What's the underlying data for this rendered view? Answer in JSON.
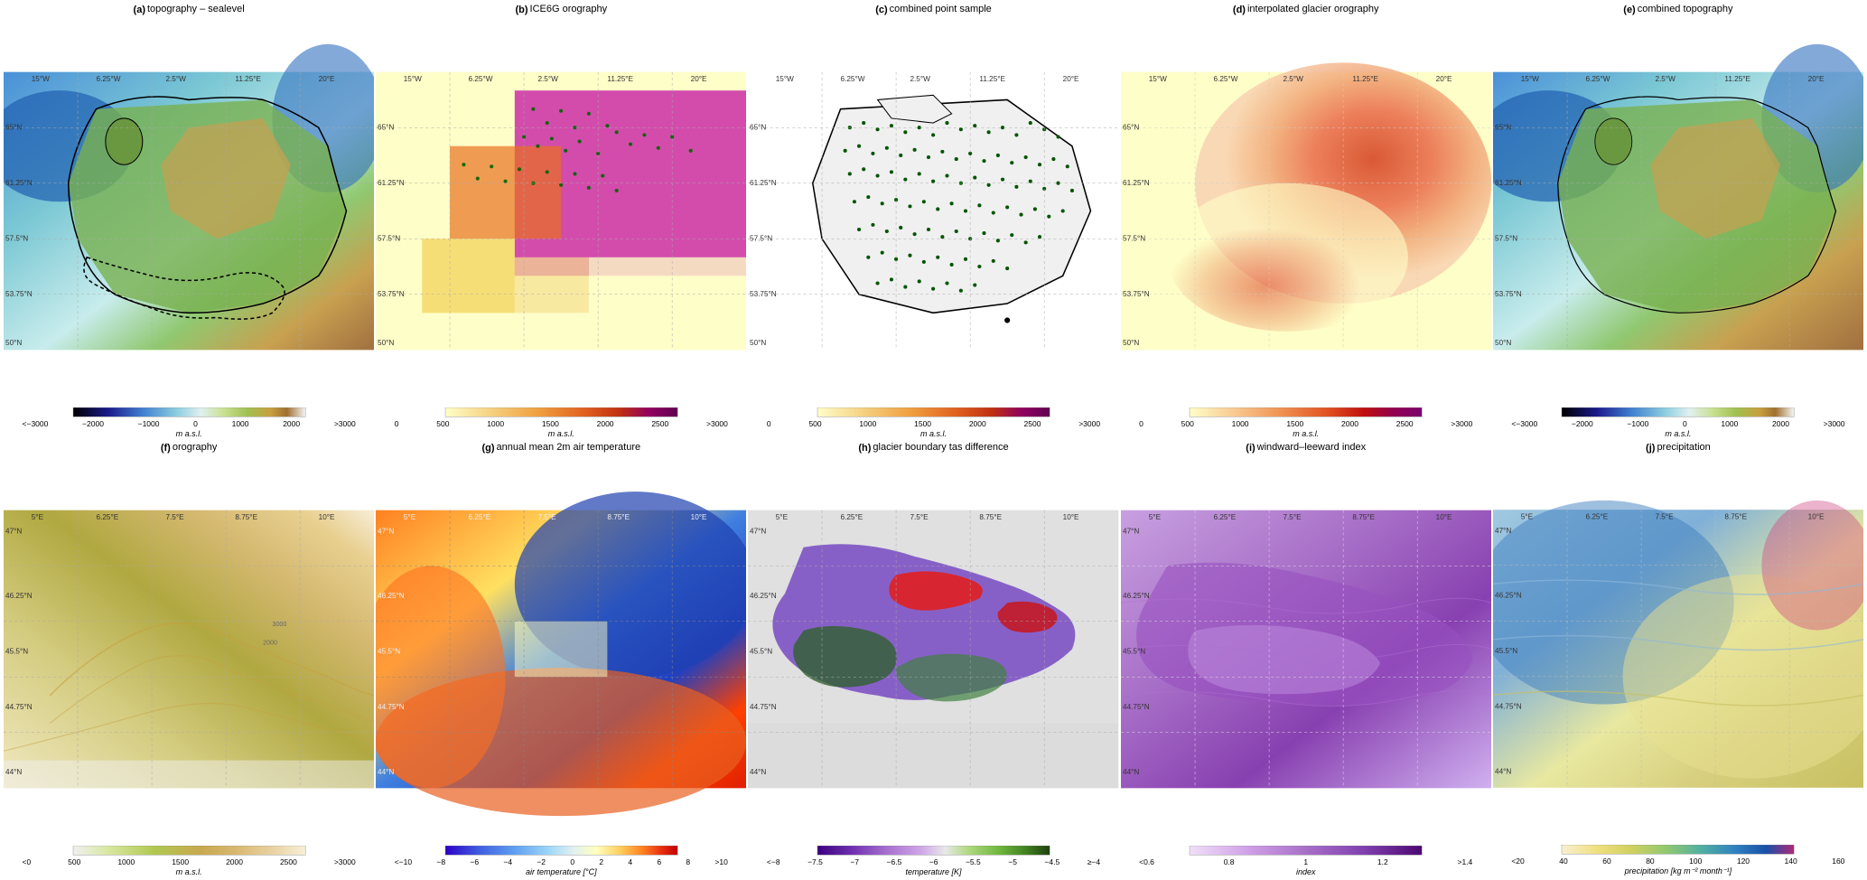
{
  "panels": {
    "row1": [
      {
        "id": "a",
        "label": "(a)",
        "title": "topography – sealevel",
        "colorbar": {
          "type": "topography_full",
          "labels": [
            "<−3000",
            "−2000",
            "−1000",
            "0",
            "1000",
            "2000",
            ">3000"
          ],
          "unit": "m a.s.l.",
          "colors": [
            "#000000",
            "#1a1a8c",
            "#2c5ff5",
            "#7db8d4",
            "#c8ecec",
            "#e8f5e0",
            "#a8d890",
            "#78b050",
            "#c8a050",
            "#c87830",
            "#8b4513",
            "#f5f5f5"
          ]
        },
        "map_style": "topography_sealevel",
        "grid_labels": {
          "top": [
            "15°W",
            "6.25°W",
            "2.5°W",
            "11.25°E",
            "20°E"
          ],
          "left": [
            "65°N",
            "61.25°N",
            "57.5°N",
            "53.75°N",
            "50°N"
          ]
        }
      },
      {
        "id": "b",
        "label": "(b)",
        "title": "ICE6G orography",
        "colorbar": {
          "type": "warm",
          "labels": [
            "0",
            "500",
            "1000",
            "1500",
            "2000",
            "2500",
            ">3000"
          ],
          "unit": "m a.s.l.",
          "colors": [
            "#fefec8",
            "#f5e090",
            "#f0b840",
            "#e87020",
            "#d03010",
            "#a00080",
            "#5c0060"
          ]
        },
        "map_style": "ice6g",
        "grid_labels": {
          "top": [
            "15°W",
            "6.25°W",
            "2.5°W",
            "11.25°E",
            "20°E"
          ],
          "left": [
            "65°N",
            "61.25°N",
            "57.5°N",
            "53.75°N",
            "50°N"
          ]
        }
      },
      {
        "id": "c",
        "label": "(c)",
        "title": "combined point sample",
        "colorbar": {
          "type": "warm",
          "labels": [
            "0",
            "500",
            "1000",
            "1500",
            "2000",
            "2500",
            ">3000"
          ],
          "unit": "m a.s.l.",
          "colors": [
            "#fefec8",
            "#f5e090",
            "#f0b840",
            "#e87020",
            "#d03010",
            "#a00080",
            "#5c0060"
          ]
        },
        "map_style": "point_sample",
        "grid_labels": {
          "top": [
            "15°W",
            "6.25°W",
            "2.5°W",
            "11.25°E",
            "20°E"
          ],
          "left": [
            "65°N",
            "61.25°N",
            "57.5°N",
            "53.75°N",
            "50°N"
          ]
        }
      },
      {
        "id": "d",
        "label": "(d)",
        "title": "interpolated glacier orography",
        "colorbar": {
          "type": "warm",
          "labels": [
            "0",
            "500",
            "1000",
            "1500",
            "2000",
            "2500",
            ">3000"
          ],
          "unit": "m a.s.l.",
          "colors": [
            "#fefec8",
            "#f5d0a0",
            "#f0a060",
            "#e06030",
            "#cc2010",
            "#aa0050",
            "#7a0070"
          ]
        },
        "map_style": "glacier_orography",
        "grid_labels": {
          "top": [
            "15°W",
            "6.25°W",
            "2.5°W",
            "11.25°E",
            "20°E"
          ],
          "left": [
            "65°N",
            "61.25°N",
            "57.5°N",
            "53.75°N",
            "50°N"
          ]
        }
      },
      {
        "id": "e",
        "label": "(e)",
        "title": "combined topography",
        "colorbar": {
          "type": "topography_full",
          "labels": [
            "<−3000",
            "−2000",
            "−1000",
            "0",
            "1000",
            "2000",
            ">3000"
          ],
          "unit": "m a.s.l.",
          "colors": [
            "#000000",
            "#1a1a8c",
            "#2c5ff5",
            "#7db8d4",
            "#c8ecec",
            "#e8f5e0",
            "#a8d890",
            "#78b050",
            "#c8a050",
            "#c87830",
            "#8b4513",
            "#f5f5f5"
          ]
        },
        "map_style": "combined_topography",
        "grid_labels": {
          "top": [
            "15°W",
            "6.25°W",
            "2.5°W",
            "11.25°E",
            "20°E"
          ],
          "left": [
            "65°N",
            "61.25°N",
            "57.5°N",
            "53.75°N",
            "50°N"
          ]
        }
      }
    ],
    "row2": [
      {
        "id": "f",
        "label": "(f)",
        "title": "orography",
        "colorbar": {
          "type": "orography",
          "labels": [
            "<0",
            "500",
            "1000",
            "1500",
            "2000",
            "2500",
            ">3000"
          ],
          "unit": "m a.s.l.",
          "colors": [
            "#e8f0c0",
            "#d0d870",
            "#a8b840",
            "#809030",
            "#b8a060",
            "#d0c080",
            "#f0e0b0",
            "#f8f0d8"
          ]
        },
        "map_style": "orography",
        "grid_labels": {
          "top": [
            "5°E",
            "6.25°E",
            "7.5°E",
            "8.75°E",
            "10°E"
          ],
          "left": [
            "47°N",
            "46.25°N",
            "45.5°N",
            "44.75°N",
            "44°N"
          ]
        }
      },
      {
        "id": "g",
        "label": "(g)",
        "title": "annual mean 2m air temperature",
        "colorbar": {
          "type": "temperature",
          "labels": [
            "<−10",
            "−8",
            "−6",
            "−4",
            "−2",
            "0",
            "2",
            "4",
            "6",
            "8",
            ">10"
          ],
          "unit": "air temperature [°C]",
          "colors": [
            "#2c00c8",
            "#4060e0",
            "#60a0f0",
            "#90d0f8",
            "#c0ecf8",
            "#ffffc0",
            "#ffd060",
            "#ff8020",
            "#e83010",
            "#c00000"
          ]
        },
        "map_style": "temperature",
        "grid_labels": {
          "top": [
            "5°E",
            "6.25°E",
            "7.5°E",
            "8.75°E",
            "10°E"
          ],
          "left": [
            "47°N",
            "46.25°N",
            "45.5°N",
            "44.75°N",
            "44°N"
          ]
        }
      },
      {
        "id": "h",
        "label": "(h)",
        "title": "glacier boundary tas difference",
        "colorbar": {
          "type": "diverging_temp",
          "labels": [
            "<−8",
            "−7.5",
            "−7",
            "−6.5",
            "−6",
            "−5.5",
            "−5",
            "−4.5",
            "≥−4"
          ],
          "unit": "temperature [K]",
          "colors": [
            "#400090",
            "#6020b0",
            "#9040d0",
            "#b880e0",
            "#d0b0f0",
            "#e8e8e8",
            "#b0d890",
            "#70b840",
            "#408020",
            "#204010"
          ]
        },
        "map_style": "tas_difference",
        "grid_labels": {
          "top": [
            "5°E",
            "6.25°E",
            "7.5°E",
            "8.75°E",
            "10°E"
          ],
          "left": [
            "47°N",
            "46.25°N",
            "45.5°N",
            "44.75°N",
            "44°N"
          ]
        }
      },
      {
        "id": "i",
        "label": "(i)",
        "title": "windward–leeward index",
        "colorbar": {
          "type": "index",
          "labels": [
            "<0.6",
            "0.8",
            "1",
            "1.2",
            ">1.4"
          ],
          "unit": "index",
          "colors": [
            "#e8d0f0",
            "#c8a0e0",
            "#a870c8",
            "#8840b0",
            "#682090",
            "#4c0870"
          ]
        },
        "map_style": "windward_index",
        "grid_labels": {
          "top": [
            "5°E",
            "6.25°E",
            "7.5°E",
            "8.75°E",
            "10°E"
          ],
          "left": [
            "47°N",
            "46.25°N",
            "45.5°N",
            "44.75°N",
            "44°N"
          ]
        }
      },
      {
        "id": "j",
        "label": "(j)",
        "title": "precipitation",
        "colorbar": {
          "type": "precipitation",
          "labels": [
            "<20",
            "40",
            "60",
            "80",
            "100",
            "120",
            "140",
            "160"
          ],
          "unit": "precipitation [kg m⁻² month⁻¹]",
          "colors": [
            "#f8f0d0",
            "#f0e090",
            "#d8d060",
            "#a0c870",
            "#60b8a0",
            "#4090c0",
            "#2060a8",
            "#183080",
            "#b03070"
          ]
        },
        "map_style": "precipitation",
        "grid_labels": {
          "top": [
            "5°E",
            "6.25°E",
            "7.5°E",
            "8.75°E",
            "10°E"
          ],
          "left": [
            "47°N",
            "46.25°N",
            "45.5°N",
            "44.75°N",
            "44°N"
          ]
        }
      }
    ]
  }
}
